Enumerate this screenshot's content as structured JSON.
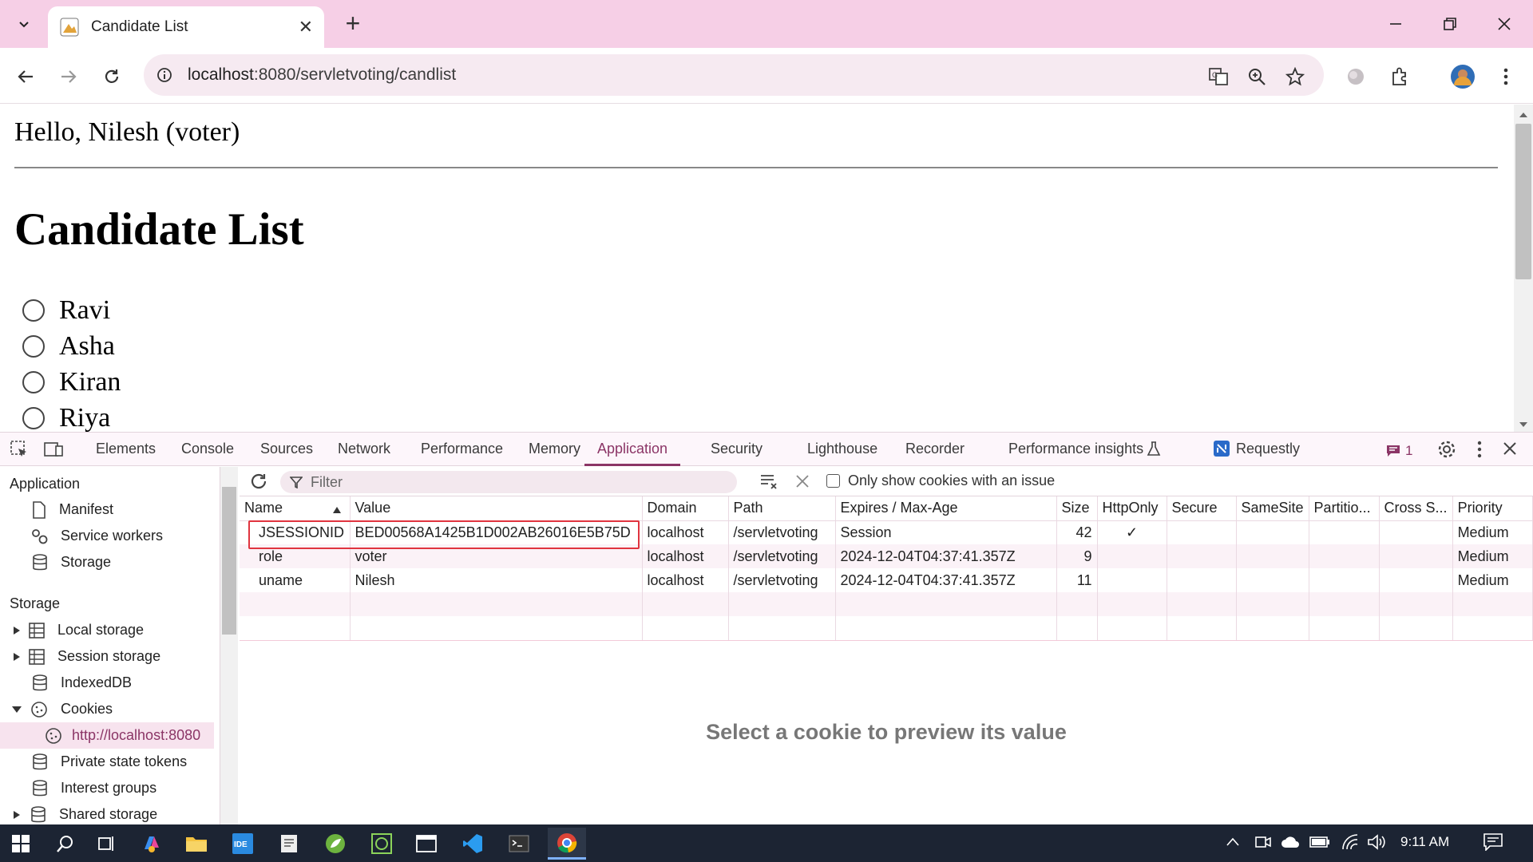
{
  "browser": {
    "tab_title": "Candidate List",
    "url_host": "localhost",
    "url_path": ":8080/servletvoting/candlist"
  },
  "page": {
    "greeting": "Hello, Nilesh (voter)",
    "heading": "Candidate List",
    "candidates": [
      "Ravi",
      "Asha",
      "Kiran",
      "Riya"
    ]
  },
  "devtools": {
    "tabs": [
      "Elements",
      "Console",
      "Sources",
      "Network",
      "Performance",
      "Memory",
      "Application",
      "Security",
      "Lighthouse",
      "Recorder",
      "Performance insights",
      "Requestly"
    ],
    "active_tab": "Application",
    "issues_count": "1",
    "sidebar": {
      "application_header": "Application",
      "application_items": [
        "Manifest",
        "Service workers",
        "Storage"
      ],
      "storage_header": "Storage",
      "storage_items": [
        "Local storage",
        "Session storage",
        "IndexedDB",
        "Cookies",
        "http://localhost:8080",
        "Private state tokens",
        "Interest groups",
        "Shared storage"
      ]
    },
    "filter_placeholder": "Filter",
    "only_issue_label": "Only show cookies with an issue",
    "columns": [
      "Name",
      "Value",
      "Domain",
      "Path",
      "Expires / Max-Age",
      "Size",
      "HttpOnly",
      "Secure",
      "SameSite",
      "Partitio...",
      "Cross S...",
      "Priority"
    ],
    "cookies": [
      {
        "name": "JSESSIONID",
        "value": "BED00568A1425B1D002AB26016E5B75D",
        "domain": "localhost",
        "path": "/servletvoting",
        "expires": "Session",
        "size": "42",
        "httponly": "✓",
        "priority": "Medium"
      },
      {
        "name": "role",
        "value": "voter",
        "domain": "localhost",
        "path": "/servletvoting",
        "expires": "2024-12-04T04:37:41.357Z",
        "size": "9",
        "httponly": "",
        "priority": "Medium"
      },
      {
        "name": "uname",
        "value": "Nilesh",
        "domain": "localhost",
        "path": "/servletvoting",
        "expires": "2024-12-04T04:37:41.357Z",
        "size": "11",
        "httponly": "",
        "priority": "Medium"
      }
    ],
    "preview_text": "Select a cookie to preview its value"
  },
  "taskbar": {
    "time": "9:11 AM"
  },
  "colors": {
    "titlebar": "#f6cfe6",
    "accent": "#8b3566",
    "highlight_border": "#e0343f"
  }
}
